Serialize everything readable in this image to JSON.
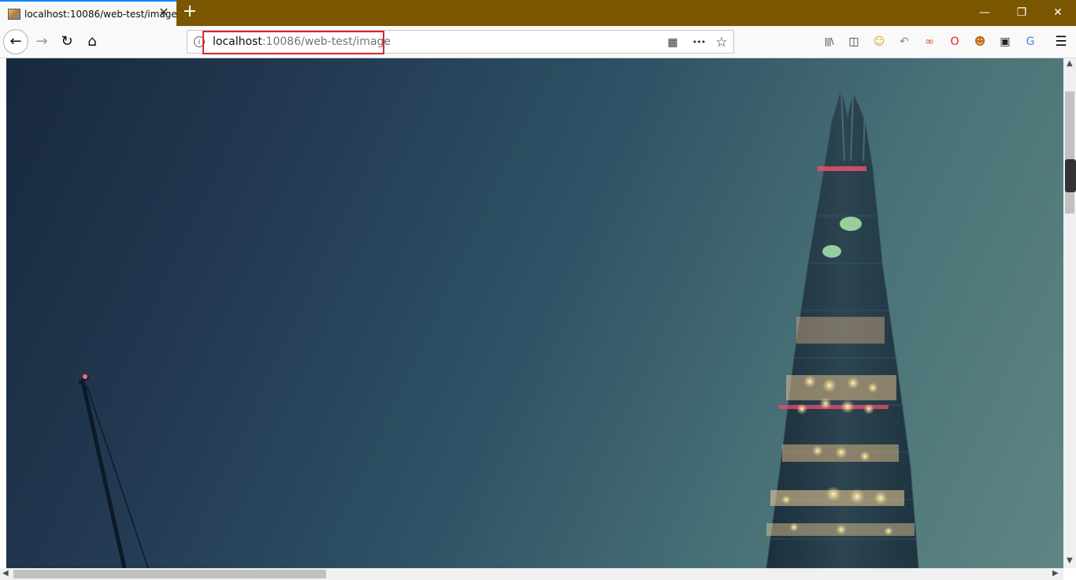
{
  "tab": {
    "title": "localhost:10086/web-test/image",
    "close_glyph": "✕",
    "favicon": "image-favicon-icon"
  },
  "new_tab_glyph": "+",
  "window_controls": {
    "minimize": "—",
    "restore": "❐",
    "close": "✕"
  },
  "nav": {
    "back": "←",
    "forward": "→",
    "reload": "↻",
    "home": "⌂"
  },
  "url": {
    "host": "localhost",
    "path": ":10086/web-test/image",
    "info_glyph": "i",
    "qr": "▦",
    "more": "•••",
    "bookmark": "☆",
    "highlight_color": "#d7262e"
  },
  "toolbar_icons": [
    {
      "name": "library-icon",
      "glyph": "|||\\",
      "color": "#333333"
    },
    {
      "name": "sidebar-icon",
      "glyph": "◫",
      "color": "#333333"
    },
    {
      "name": "extension-face-icon",
      "glyph": "☺",
      "color": "#e0a020"
    },
    {
      "name": "undo-extension-icon",
      "glyph": "↶",
      "color": "#888888"
    },
    {
      "name": "glasses-extension-icon",
      "glyph": "∞",
      "color": "#e84a2a"
    },
    {
      "name": "opera-extension-icon",
      "glyph": "O",
      "color": "#e02020"
    },
    {
      "name": "nerd-extension-icon",
      "glyph": "☻",
      "color": "#c07020"
    },
    {
      "name": "tab-extension-icon",
      "glyph": "▣",
      "color": "#222222"
    },
    {
      "name": "translate-extension-icon",
      "glyph": "G",
      "color": "#4a80e8"
    }
  ],
  "menu_glyph": "☰",
  "scroll": {
    "up": "▲",
    "down": "▼",
    "left": "◀",
    "right": "▶"
  },
  "colors": {
    "titlebar": "#7b5600",
    "tab_accent": "#0a84ff"
  }
}
